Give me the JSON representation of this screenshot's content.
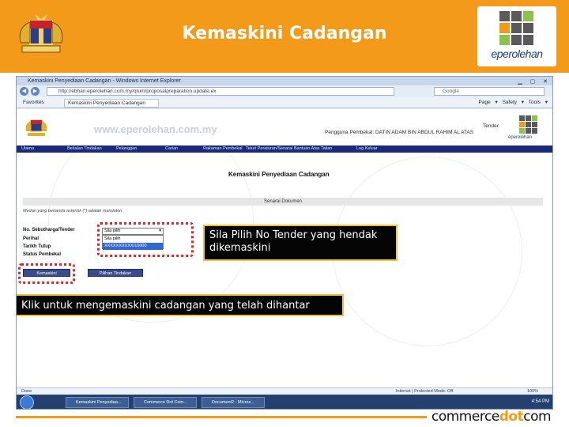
{
  "header": {
    "title": "Kemaskini Cadangan",
    "logo_text": "eperolehan"
  },
  "browser": {
    "window_title": "Kemaskini Penyediaan Cadangan - Windows Internet Explorer",
    "window_buttons": "▁ ▢ ✕",
    "url": "http://ebhan.eperolehan.com.my/qtum/proposalpreparation.update.ex",
    "search_placeholder": "Google",
    "favorites_label": "Favorites",
    "tab_label": "Kemaskini Penyediaan Cadangan",
    "commands": "Page ▾ Safety ▾ Tools ▾"
  },
  "site": {
    "url": "www.eperolehan.com.my",
    "user": "Pengguna Pembekal: DATIN ADAM BIN ABDUL RAHIM AL ATAS",
    "tender": "Tender",
    "logo_text": "eperolehan",
    "menu": [
      "Utama",
      "Bekalan Tindakan",
      "Pelanggan",
      "Carian",
      "Rakaman Pembekal",
      "Teluri Peraturan/Senarai Bantuan Atas Talian",
      "Log Keluar"
    ],
    "page_heading": "Kemaskini Penyediaan Cadangan",
    "section_title": "Senarai Dokumen",
    "mandatory_note": "Medan yang bertanda asterisk (*) adalah mandatori.",
    "form_labels": [
      "No. Sebutharga/Tender",
      "Perihal",
      "Tarikh Tutup",
      "Status Pembekal"
    ],
    "select_value": "Sila pilih",
    "dropdown_options": [
      "Sila pilih",
      "XXXXXXXXXX/10000"
    ],
    "buttons": [
      "Kemaskini",
      "Pilihan Tindakan"
    ]
  },
  "callouts": {
    "select_tender": "Sila Pilih No Tender yang hendak dikemaskini",
    "update_button": "Klik untuk mengemaskini cadangan yang telah dihantar"
  },
  "statusbar": {
    "left": "Done",
    "right": "Internet | Protected Mode: Off",
    "zoom": "100%"
  },
  "taskbar": {
    "items": [
      "Kemaskini Penyediaa...",
      "Commerce Dot Com...",
      "Document2 - Micros..."
    ],
    "clock": "4:54 PM"
  },
  "footer": {
    "logo_part1": "commerce",
    "logo_part2": "dot",
    "logo_part3": "com"
  },
  "colors": {
    "header_orange": "#f39a1a",
    "callout_border": "#f2c230",
    "highlight_ring": "#e41f26"
  }
}
